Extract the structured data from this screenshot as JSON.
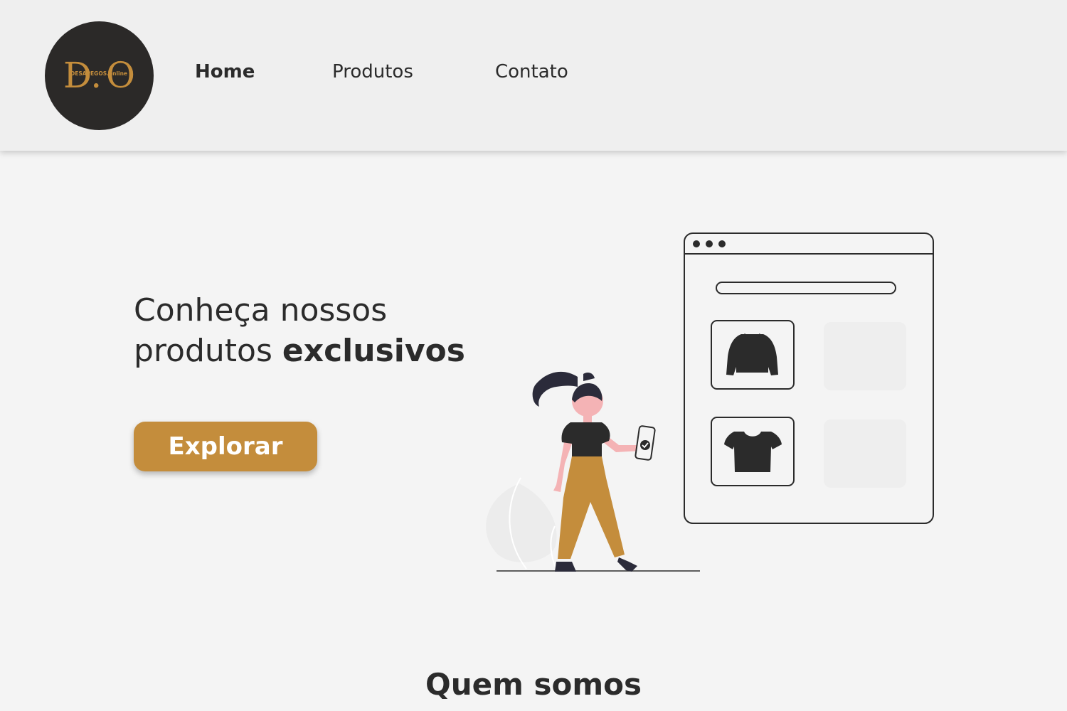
{
  "brand": {
    "logo_initials_left": "D.",
    "logo_initials_right": "O",
    "logo_text": "DESAPEGOS.online",
    "logo_bg": "#2b2928",
    "logo_color": "#c48d3c"
  },
  "nav": {
    "items": [
      {
        "label": "Home",
        "active": true
      },
      {
        "label": "Produtos",
        "active": false
      },
      {
        "label": "Contato",
        "active": false
      }
    ]
  },
  "hero": {
    "title_line1": "Conheça nossos",
    "title_line2_regular": "produtos ",
    "title_line2_bold": "exclusivos",
    "cta_label": "Explorar"
  },
  "illustration": {
    "icons": [
      "browser-window-icon",
      "sweater-icon",
      "crop-top-icon",
      "woman-with-phone-icon"
    ]
  },
  "sections": {
    "about_title": "Quem somos"
  },
  "colors": {
    "accent": "#c48d3c",
    "text": "#2b2b2b",
    "background": "#f4f4f4",
    "header_bg": "#efefef"
  }
}
